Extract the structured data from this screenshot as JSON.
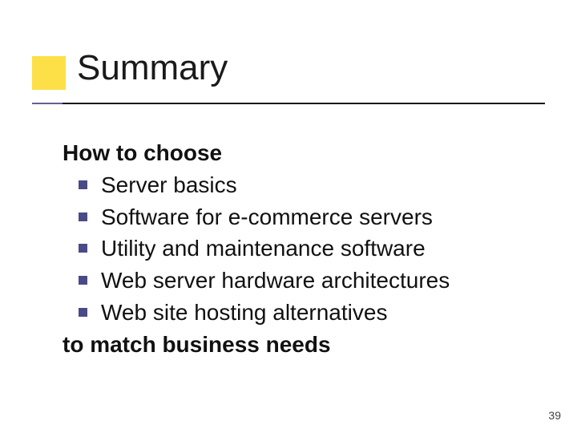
{
  "slide": {
    "title": "Summary",
    "lead": "How to choose",
    "bullets": [
      "Server basics",
      "Software for e-commerce servers",
      "Utility and maintenance software",
      "Web server hardware architectures",
      "Web site hosting alternatives"
    ],
    "tail": "to match business needs",
    "page_number": "39"
  },
  "colors": {
    "accent_yellow": "#fde047",
    "accent_purple": "#6b5c8f",
    "bullet_square": "#4a4a88"
  }
}
